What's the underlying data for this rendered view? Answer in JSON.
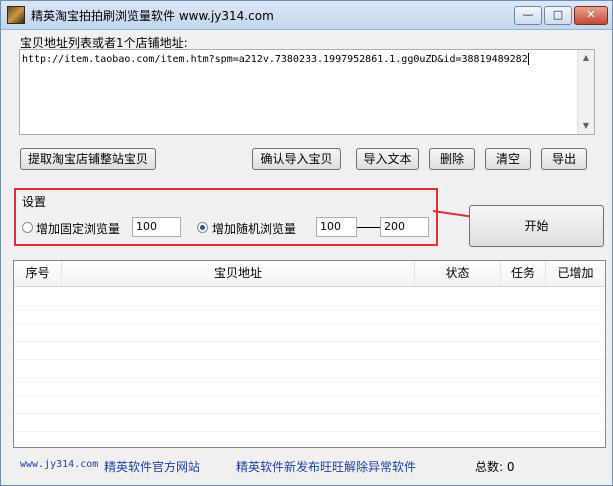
{
  "window": {
    "title": "精英淘宝拍拍刷浏览量软件 www.jy314.com"
  },
  "titlebar_buttons": {
    "minimize": "—",
    "maximize": "□",
    "close": "✕"
  },
  "url_section": {
    "label": "宝贝地址列表或者1个店铺地址:",
    "value": "http://item.taobao.com/item.htm?spm=a212v.7380233.1997952861.1.gg0uZD&id=38819489282"
  },
  "toolbar": {
    "fetch_shop_label": "提取淘宝店铺整站宝贝",
    "confirm_import_label": "确认导入宝贝",
    "import_text_label": "导入文本",
    "delete_label": "删除",
    "clear_label": "清空",
    "export_label": "导出"
  },
  "settings": {
    "title": "设置",
    "fixed_option": {
      "label": "增加固定浏览量",
      "value": "100",
      "selected": false
    },
    "random_option": {
      "label": "增加随机浏览量",
      "min": "100",
      "max": "200",
      "selected": true
    }
  },
  "start_button": {
    "label": "开始"
  },
  "grid": {
    "columns": [
      "序号",
      "宝贝地址",
      "状态",
      "任务",
      "已增加"
    ],
    "rows": []
  },
  "footer": {
    "site_url": "www.jy314.com",
    "site_label": "精英软件官方网站",
    "promo": "精英软件新发布旺旺解除异常软件",
    "total_label": "总数:",
    "total_value": "0"
  },
  "annotation_color": "#e0312f"
}
